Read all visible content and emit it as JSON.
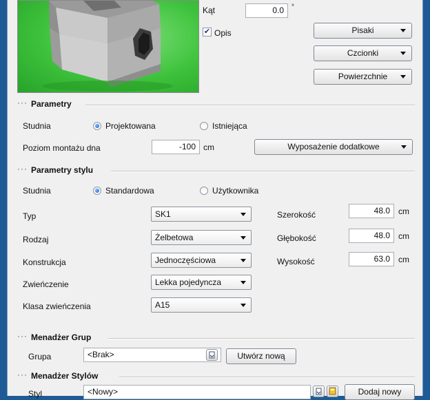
{
  "top": {
    "angle_label": "Kąt",
    "angle_value": "0.0",
    "angle_unit": "°",
    "desc_checkbox_label": "Opis",
    "desc_checked": true,
    "btn_pens": "Pisaki",
    "btn_fonts": "Czcionki",
    "btn_surfaces": "Powierzchnie"
  },
  "parameters": {
    "title": "Parametry",
    "well_label": "Studnia",
    "radio_designed": "Projektowana",
    "radio_existing": "Istniejąca",
    "selected": "Projektowana",
    "bottom_level_label": "Poziom montażu dna",
    "bottom_level_value": "-100",
    "bottom_level_unit": "cm",
    "btn_extra_equipment": "Wyposażenie dodatkowe"
  },
  "style_parameters": {
    "title": "Parametry stylu",
    "well_label": "Studnia",
    "radio_standard": "Standardowa",
    "radio_user": "Użytkownika",
    "selected": "Standardowa",
    "type_label": "Typ",
    "type_value": "SK1",
    "kind_label": "Rodzaj",
    "kind_value": "Żelbetowa",
    "construction_label": "Konstrukcja",
    "construction_value": "Jednoczęściowa",
    "top_label": "Zwieńczenie",
    "top_value": "Lekka pojedyncza",
    "top_class_label": "Klasa zwieńczenia",
    "top_class_value": "A15",
    "width_label": "Szerokość",
    "width_value": "48.0",
    "depth_label": "Głębokość",
    "depth_value": "48.0",
    "height_label": "Wysokość",
    "height_value": "63.0",
    "unit": "cm"
  },
  "group_manager": {
    "title": "Menadżer Grup",
    "group_label": "Grupa",
    "group_value": "<Brak>",
    "btn_create_new": "Utwórz nową"
  },
  "style_manager": {
    "title": "Menadżer Stylów",
    "style_label": "Styl",
    "style_value": "<Nowy>",
    "btn_add_new": "Dodaj nowy"
  },
  "colors": {
    "preview_green": "#3ec23c",
    "window_frame": "#1e5b96"
  },
  "icons": {
    "section_marker": "dotted-marker",
    "combo_arrow": "chevron-down-icon"
  }
}
